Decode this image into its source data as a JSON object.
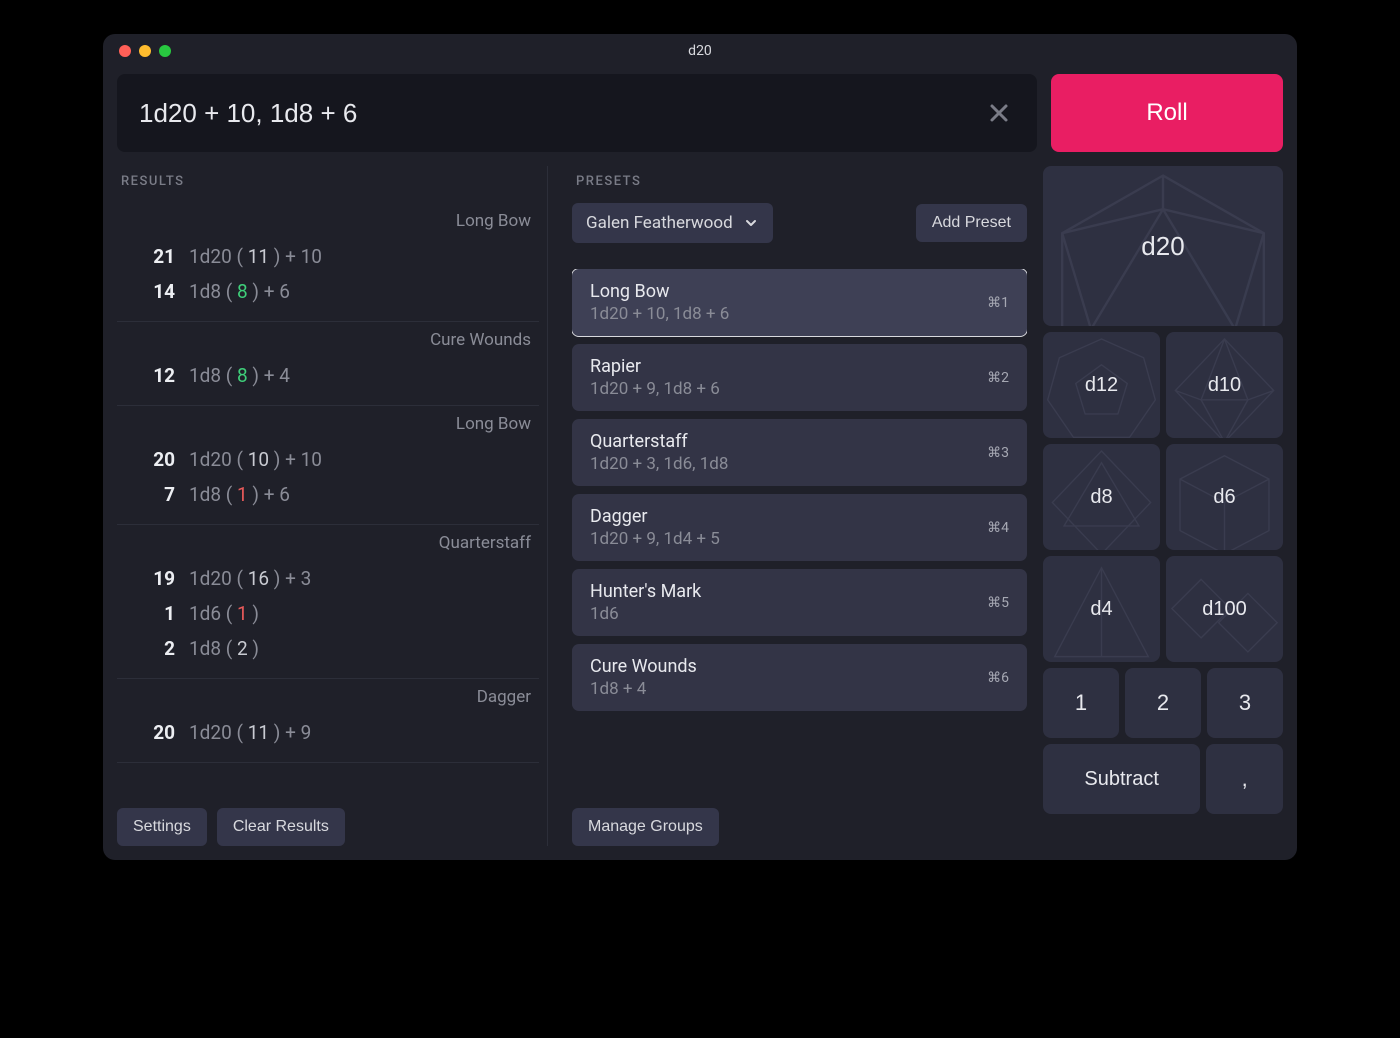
{
  "window": {
    "title": "d20"
  },
  "formula": {
    "value": "1d20 + 10, 1d8 + 6",
    "roll_label": "Roll"
  },
  "results": {
    "label": "RESULTS",
    "settings_label": "Settings",
    "clear_label": "Clear Results",
    "groups": [
      {
        "name": "Long Bow",
        "lines": [
          {
            "total": "21",
            "prefix": "1d20 ( ",
            "roll": "11",
            "roll_class": "neutral",
            "suffix": " ) + 10"
          },
          {
            "total": "14",
            "prefix": "1d8 ( ",
            "roll": "8",
            "roll_class": "good",
            "suffix": " ) + 6"
          }
        ]
      },
      {
        "name": "Cure Wounds",
        "lines": [
          {
            "total": "12",
            "prefix": "1d8 ( ",
            "roll": "8",
            "roll_class": "good",
            "suffix": " ) + 4"
          }
        ]
      },
      {
        "name": "Long Bow",
        "lines": [
          {
            "total": "20",
            "prefix": "1d20 ( ",
            "roll": "10",
            "roll_class": "neutral",
            "suffix": " ) + 10"
          },
          {
            "total": "7",
            "prefix": "1d8 ( ",
            "roll": "1",
            "roll_class": "bad",
            "suffix": " ) + 6"
          }
        ]
      },
      {
        "name": "Quarterstaff",
        "lines": [
          {
            "total": "19",
            "prefix": "1d20 ( ",
            "roll": "16",
            "roll_class": "neutral",
            "suffix": " ) + 3"
          },
          {
            "total": "1",
            "prefix": "1d6 ( ",
            "roll": "1",
            "roll_class": "bad",
            "suffix": " )"
          },
          {
            "total": "2",
            "prefix": "1d8 ( ",
            "roll": "2",
            "roll_class": "neutral",
            "suffix": " )"
          }
        ]
      },
      {
        "name": "Dagger",
        "lines": [
          {
            "total": "20",
            "prefix": "1d20 ( ",
            "roll": "11",
            "roll_class": "neutral",
            "suffix": " ) + 9"
          }
        ]
      }
    ]
  },
  "presets": {
    "label": "PRESETS",
    "group_selected": "Galen Featherwood",
    "add_label": "Add Preset",
    "manage_label": "Manage Groups",
    "items": [
      {
        "name": "Long Bow",
        "formula": "1d20 + 10, 1d8 + 6",
        "shortcut": "⌘1",
        "selected": true
      },
      {
        "name": "Rapier",
        "formula": "1d20 + 9, 1d8 + 6",
        "shortcut": "⌘2",
        "selected": false
      },
      {
        "name": "Quarterstaff",
        "formula": "1d20 + 3, 1d6, 1d8",
        "shortcut": "⌘3",
        "selected": false
      },
      {
        "name": "Dagger",
        "formula": "1d20 + 9, 1d4 + 5",
        "shortcut": "⌘4",
        "selected": false
      },
      {
        "name": "Hunter's Mark",
        "formula": "1d6",
        "shortcut": "⌘5",
        "selected": false
      },
      {
        "name": "Cure Wounds",
        "formula": "1d8 + 4",
        "shortcut": "⌘6",
        "selected": false
      }
    ]
  },
  "dice": {
    "d20": "d20",
    "d12": "d12",
    "d10": "d10",
    "d8": "d8",
    "d6": "d6",
    "d4": "d4",
    "d100": "d100",
    "n1": "1",
    "n2": "2",
    "n3": "3",
    "subtract": "Subtract",
    "comma": ","
  }
}
